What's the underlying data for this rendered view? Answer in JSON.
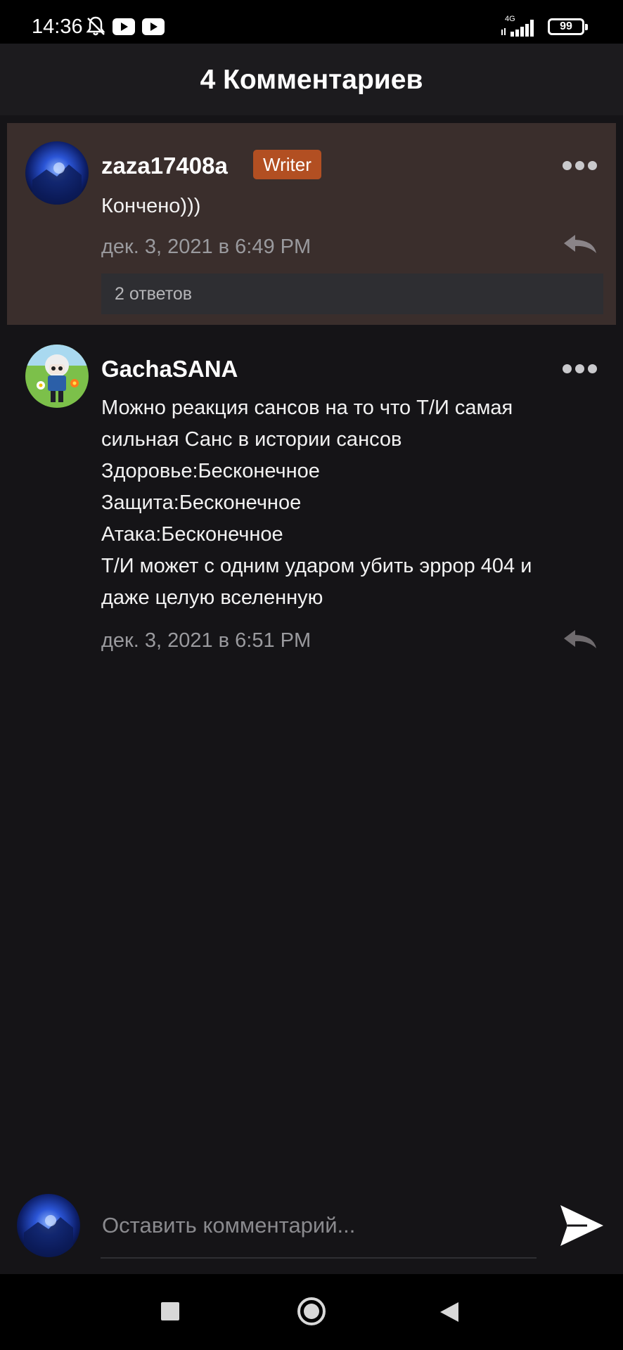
{
  "status_bar": {
    "time": "14:36",
    "icons": [
      "bell-off-icon",
      "youtube-icon",
      "youtube-icon"
    ],
    "network": "4G",
    "battery": "99"
  },
  "header": {
    "title": "4 Комментариев"
  },
  "comments": [
    {
      "username": "zaza17408a",
      "badge": "Writer",
      "text": "Кончено)))",
      "date": "дек. 3, 2021 в 6:49 PM",
      "replies": "2 ответов",
      "highlighted": true
    },
    {
      "username": "GachaSANA",
      "text": "Можно реакция сансов на то что Т/И самая\nсильная Санс в истории сансов\nЗдоровье:Бесконечное\nЗащита:Бесконечное\nАтака:Бесконечное\nТ/И может с одним ударом убить эррор 404 и\nдаже целую вселенную",
      "date": "дек. 3, 2021 в 6:51 PM"
    }
  ],
  "composer": {
    "placeholder": "Оставить комментарий..."
  },
  "colors": {
    "background": "#151417",
    "header": "#1c1b1e",
    "highlight": "#3a2e2c",
    "badge": "#b24f22"
  }
}
